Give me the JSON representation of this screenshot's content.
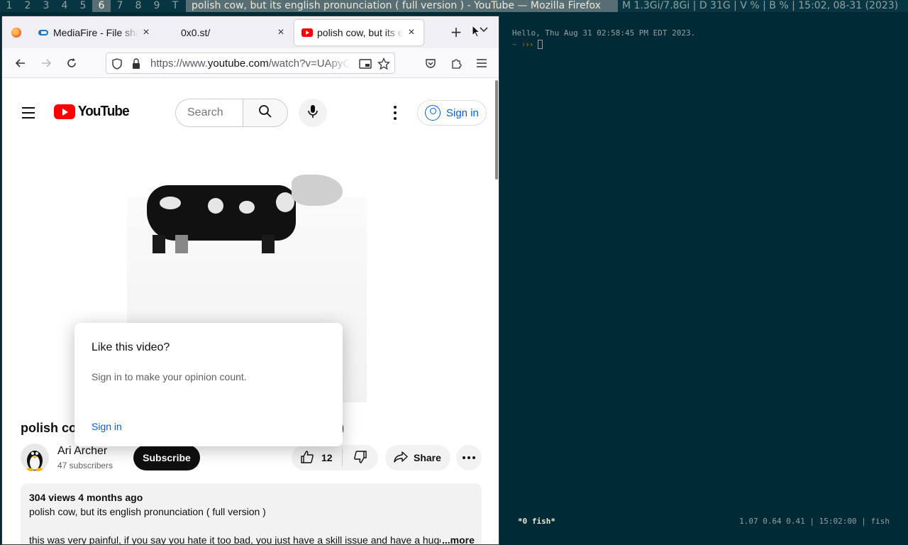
{
  "statusbar": {
    "workspaces": [
      "1",
      "2",
      "3",
      "4",
      "5",
      "6",
      "7",
      "8",
      "9",
      "T"
    ],
    "active_workspace": "6",
    "window_title": "polish cow, but its english pronunciation ( full version ) - YouTube — Mozilla Firefox",
    "system_info": "M 1.3Gi/7.8Gi | D 31G | V % | B % | 15:02, 08-31 (2023)"
  },
  "browser": {
    "tabs": [
      {
        "label": "MediaFire - File sharing and storage",
        "icon": "mediafire-icon"
      },
      {
        "label": "0x0.st/",
        "icon": "none"
      },
      {
        "label": "polish cow, but its english pronunciation",
        "icon": "youtube-icon",
        "active": true
      }
    ],
    "new_tab_label": "+",
    "url_prefix": "https://www.",
    "url_host": "youtube.com",
    "url_rest": "/watch?v=UApyQ"
  },
  "youtube": {
    "logo_text": "YouTube",
    "search_placeholder": "Search",
    "sign_in_label": "Sign in",
    "video_title_start": "polish co",
    "video_title_end": ")",
    "channel_name": "Ari Archer",
    "subscribers": "47 subscribers",
    "subscribe_label": "Subscribe",
    "likes": "12",
    "share_label": "Share",
    "description": {
      "meta": "304 views  4 months ago",
      "line1": "polish cow, but its english pronunciation ( full version )",
      "line2": "this was very painful, if you say you hate it too bad, you just have a skill issue and have a huge",
      "more_label": "...more"
    },
    "popup": {
      "heading": "Like this video?",
      "body": "Sign in to make your opinion count.",
      "sign_in_label": "Sign in"
    }
  },
  "terminal": {
    "greeting": "Hello, Thu Aug 31 02:58:45 PM EDT 2023.",
    "prompt_prefix": "~",
    "tmux_left": "*0 fish*",
    "tmux_right": "1.07 0.64 0.41 | 15:02:00 | fish"
  },
  "colors": {
    "terminal_bg": "#002b36",
    "youtube_red": "#ff0000",
    "link_blue": "#065fd4"
  }
}
